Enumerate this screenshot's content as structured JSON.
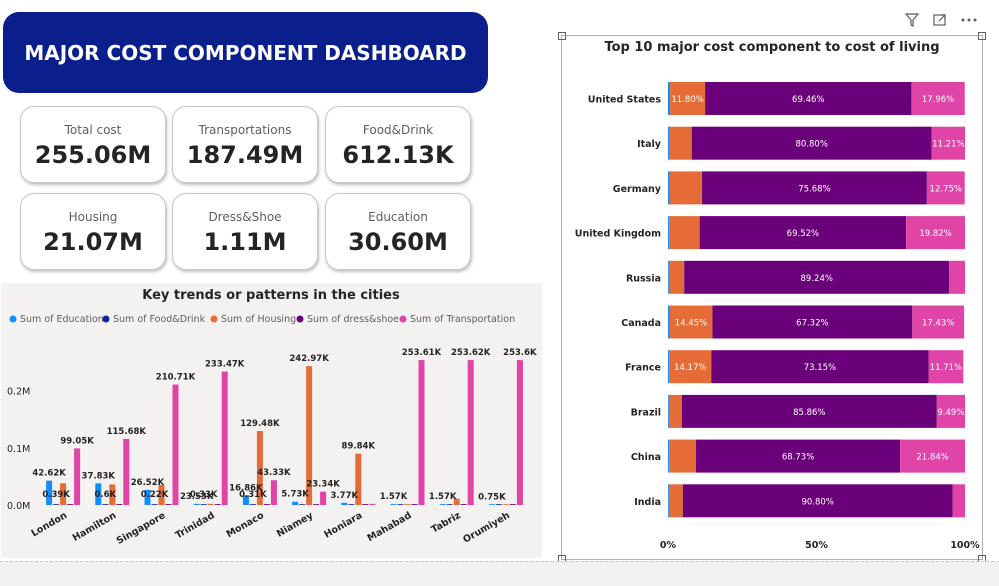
{
  "dashboard": {
    "title": "MAJOR COST COMPONENT DASHBOARD",
    "kpis": [
      {
        "label": "Total cost",
        "value": "255.06M"
      },
      {
        "label": "Transportations",
        "value": "187.49M"
      },
      {
        "label": "Food&Drink",
        "value": "612.13K"
      },
      {
        "label": "Housing",
        "value": "21.07M"
      },
      {
        "label": "Dress&Shoe",
        "value": "1.11M"
      },
      {
        "label": "Education",
        "value": "30.60M"
      }
    ]
  },
  "toolbar": {
    "filter_icon": "filter-icon",
    "focus_icon": "focus-mode-icon",
    "more_icon": "more-options-icon"
  },
  "colors": {
    "education": "#118dff",
    "food": "#12239e",
    "housing": "#e66c37",
    "dress": "#6b007b",
    "transport": "#e044a7",
    "title_bg": "#0b1f8c"
  },
  "chart_data": [
    {
      "type": "bar",
      "title": "Key trends or patterns in the cities",
      "ylim": [
        0,
        0.28
      ],
      "yticks": [
        "0.0M",
        "0.1M",
        "0.2M"
      ],
      "categories": [
        "London",
        "Hamilton",
        "Singapore",
        "Trinidad",
        "Monaco",
        "Niamey",
        "Honiara",
        "Mahabad",
        "Tabriz",
        "Orumiyeh"
      ],
      "series": [
        {
          "name": "Sum of Education",
          "color": "#118dff",
          "values": [
            0.04262,
            0.03783,
            0.02652,
            0.002,
            0.01686,
            0.00573,
            0.00377,
            0.00157,
            0.00157,
            0.00075
          ]
        },
        {
          "name": "Sum of Food&Drink",
          "color": "#12239e",
          "values": [
            0.00039,
            0.0006,
            0.00022,
            0.00033,
            0.00031,
            0.0003,
            0.0002,
            0.0002,
            0.0002,
            0.0002
          ]
        },
        {
          "name": "Sum of Housing",
          "color": "#e66c37",
          "values": [
            0.038,
            0.036,
            0.035,
            0.002,
            0.12948,
            0.24297,
            0.08984,
            0.0005,
            0.011,
            0.0005
          ]
        },
        {
          "name": "Sum of dress&shoe",
          "color": "#6b007b",
          "values": [
            0.0015,
            0.0015,
            0.0015,
            0.0015,
            0.0015,
            0.0015,
            0.0015,
            0.0015,
            0.0015,
            0.0015
          ]
        },
        {
          "name": "Sum of Transportation",
          "color": "#e044a7",
          "values": [
            0.09905,
            0.11568,
            0.21071,
            0.23347,
            0.04333,
            0.02334,
            0.002,
            0.25361,
            0.25362,
            0.2536
          ]
        }
      ],
      "data_labels": [
        {
          "city": 0,
          "series": 4,
          "text": "99.05K"
        },
        {
          "city": 0,
          "series": 0,
          "text": "42.62K"
        },
        {
          "city": 0,
          "series": 1,
          "text": "0.39K"
        },
        {
          "city": 1,
          "series": 4,
          "text": "115.68K"
        },
        {
          "city": 1,
          "series": 0,
          "text": "37.83K"
        },
        {
          "city": 1,
          "series": 1,
          "text": "0.6K"
        },
        {
          "city": 2,
          "series": 4,
          "text": "210.71K"
        },
        {
          "city": 2,
          "series": 0,
          "text": "26.52K"
        },
        {
          "city": 2,
          "series": 1,
          "text": "0.22K"
        },
        {
          "city": 3,
          "series": 4,
          "text": "233.47K"
        },
        {
          "city": 3,
          "series": 0,
          "text": "23.53K"
        },
        {
          "city": 3,
          "series": 1,
          "text": "0.33K"
        },
        {
          "city": 4,
          "series": 2,
          "text": "129.48K"
        },
        {
          "city": 4,
          "series": 4,
          "text": "43.33K"
        },
        {
          "city": 4,
          "series": 0,
          "text": "16.86K"
        },
        {
          "city": 4,
          "series": 1,
          "text": "0.31K"
        },
        {
          "city": 5,
          "series": 2,
          "text": "242.97K"
        },
        {
          "city": 5,
          "series": 4,
          "text": "23.34K"
        },
        {
          "city": 5,
          "series": 0,
          "text": "5.73K"
        },
        {
          "city": 6,
          "series": 2,
          "text": "89.84K"
        },
        {
          "city": 6,
          "series": 0,
          "text": "3.77K"
        },
        {
          "city": 7,
          "series": 4,
          "text": "253.61K"
        },
        {
          "city": 7,
          "series": 0,
          "text": "1.57K"
        },
        {
          "city": 8,
          "series": 4,
          "text": "253.62K"
        },
        {
          "city": 8,
          "series": 0,
          "text": "1.57K"
        },
        {
          "city": 9,
          "series": 4,
          "text": "253.6K"
        },
        {
          "city": 9,
          "series": 0,
          "text": "0.75K"
        }
      ]
    },
    {
      "type": "bar",
      "orientation": "horizontal-100%-stacked",
      "title": "Top 10 major cost component to cost of living",
      "xticks": [
        "0%",
        "50%",
        "100%"
      ],
      "categories": [
        "United States",
        "Italy",
        "Germany",
        "United Kingdom",
        "Russia",
        "Canada",
        "France",
        "Brazil",
        "China",
        "India"
      ],
      "series": [
        {
          "name": "Education",
          "color": "#118dff",
          "values": [
            0.7,
            0.6,
            0.5,
            0.4,
            0.3,
            0.5,
            0.4,
            0.3,
            0.4,
            0.3
          ]
        },
        {
          "name": "Housing",
          "color": "#e66c37",
          "values": [
            11.8,
            7.39,
            10.97,
            10.26,
            5.16,
            14.45,
            14.17,
            4.35,
            9.03,
            4.7
          ]
        },
        {
          "name": "dress&shoe",
          "color": "#6b007b",
          "values": [
            69.46,
            80.8,
            75.68,
            69.52,
            89.24,
            67.32,
            73.15,
            85.86,
            68.73,
            90.8
          ]
        },
        {
          "name": "Transportation",
          "color": "#e044a7",
          "values": [
            17.96,
            11.21,
            12.75,
            19.82,
            5.3,
            17.43,
            11.71,
            9.49,
            21.84,
            4.2
          ]
        }
      ],
      "segment_labels": [
        [
          "",
          "11.80%",
          "69.46%",
          "17.96%"
        ],
        [
          "",
          "",
          "80.80%",
          "11.21%"
        ],
        [
          "",
          "",
          "75.68%",
          "12.75%"
        ],
        [
          "",
          "",
          "69.52%",
          "19.82%"
        ],
        [
          "",
          "",
          "89.24%",
          ""
        ],
        [
          "",
          "14.45%",
          "67.32%",
          "17.43%"
        ],
        [
          "",
          "14.17%",
          "73.15%",
          "11.71%"
        ],
        [
          "",
          "",
          "85.86%",
          "9.49%"
        ],
        [
          "",
          "",
          "68.73%",
          "21.84%"
        ],
        [
          "",
          "",
          "90.80%",
          ""
        ]
      ]
    }
  ]
}
